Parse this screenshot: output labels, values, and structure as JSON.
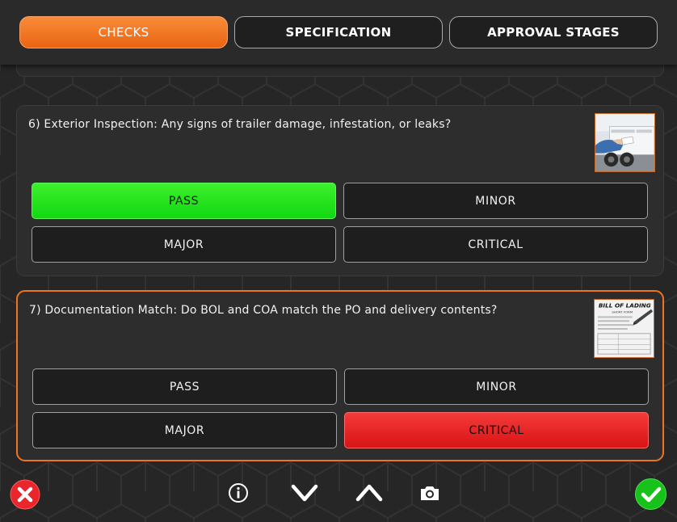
{
  "tabs": [
    {
      "label": "CHECKS",
      "active": true
    },
    {
      "label": "SPECIFICATION",
      "active": false
    },
    {
      "label": "APPROVAL STAGES",
      "active": false
    }
  ],
  "checks": [
    {
      "question": "6) Exterior Inspection: Any signs of trailer damage, infestation, or leaks?",
      "image_icon": "trailer-inspection-photo",
      "options": [
        "PASS",
        "MINOR",
        "MAJOR",
        "CRITICAL"
      ],
      "selected": "PASS"
    },
    {
      "question": "7) Documentation Match: Do BOL and COA match the PO and delivery contents?",
      "image_icon": "bill-of-lading-photo",
      "image_caption": "BILL OF LADING",
      "image_subcaption": "SHORT FORM",
      "options": [
        "PASS",
        "MINOR",
        "MAJOR",
        "CRITICAL"
      ],
      "selected": "CRITICAL"
    }
  ],
  "toolbar": {
    "cancel_icon": "close-icon",
    "info_icon": "info-icon",
    "down_icon": "chevron-down-icon",
    "up_icon": "chevron-up-icon",
    "camera_icon": "camera-icon",
    "confirm_icon": "checkmark-icon"
  },
  "colors": {
    "accent": "#ee741e",
    "pass": "#22e11c",
    "critical": "#e41f1f",
    "background": "#262626"
  }
}
